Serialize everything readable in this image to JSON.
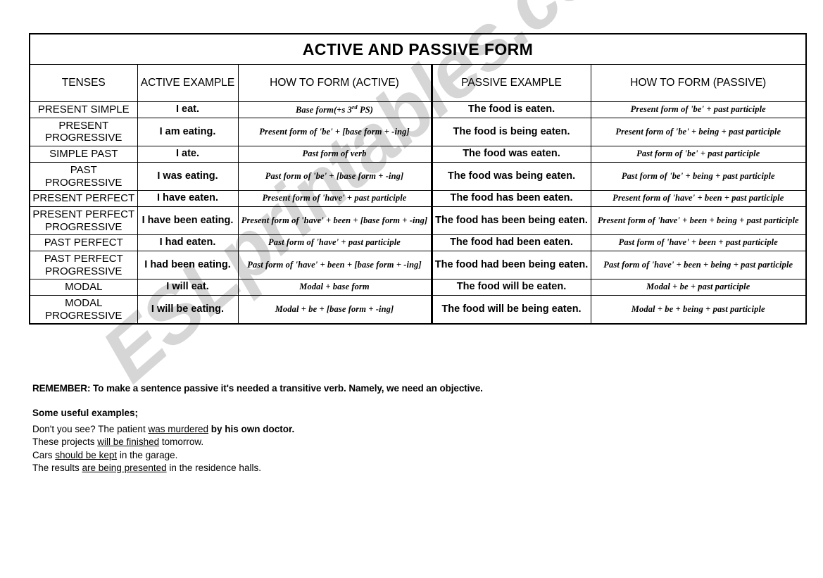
{
  "document": {
    "title": "ACTIVE AND PASSIVE FORM",
    "watermark": "ESLprintables.com"
  },
  "table": {
    "headers": {
      "tenses": "TENSES",
      "active_example": "ACTIVE EXAMPLE",
      "how_to_form_active": "HOW TO FORM (ACTIVE)",
      "passive_example": "PASSIVE EXAMPLE",
      "how_to_form_passive": "HOW TO FORM (PASSIVE)"
    },
    "rows": [
      {
        "tense": "PRESENT SIMPLE",
        "active_example": "I eat.",
        "active_form_pre": "Base form(+s 3",
        "active_form_sup": "rd",
        "active_form_post": " PS)",
        "passive_example": "The food is eaten.",
        "passive_form": "Present form of 'be' + past participle"
      },
      {
        "tense": "PRESENT PROGRESSIVE",
        "active_example": "I am eating.",
        "active_form": "Present form of 'be' + [base form + -ing]",
        "passive_example": "The food is being eaten.",
        "passive_form": "Present form of 'be' + being + past participle"
      },
      {
        "tense": "SIMPLE PAST",
        "active_example": "I ate.",
        "active_form": "Past form of verb",
        "passive_example": "The food was eaten.",
        "passive_form": "Past form of 'be' + past participle"
      },
      {
        "tense": "PAST PROGRESSIVE",
        "active_example": "I was eating.",
        "active_form": "Past form of 'be' + [base form + -ing]",
        "passive_example": "The food was being eaten.",
        "passive_form": "Past form of 'be' + being + past participle"
      },
      {
        "tense": "PRESENT PERFECT",
        "active_example": "I have eaten.",
        "active_form": "Present form of 'have' + past participle",
        "passive_example": "The food has been eaten.",
        "passive_form": "Present form of 'have' + been + past participle"
      },
      {
        "tense": "PRESENT PERFECT PROGRESSIVE",
        "active_example": "I have been eating.",
        "active_form": "Present form of 'have' + been + [base form + -ing]",
        "passive_example": "The food has been being eaten.",
        "passive_form": "Present form of 'have' + been + being + past participle"
      },
      {
        "tense": "PAST PERFECT",
        "active_example": "I had eaten.",
        "active_form": "Past form of 'have' + past participle",
        "passive_example": "The food had been eaten.",
        "passive_form": "Past form of 'have' + been + past participle"
      },
      {
        "tense": "PAST PERFECT PROGRESSIVE",
        "active_example": "I had been eating.",
        "active_form": "Past form of 'have' + been + [base form + -ing]",
        "passive_example": "The food had been being eaten.",
        "passive_form": "Past form of 'have' + been + being + past participle"
      },
      {
        "tense": "MODAL",
        "active_example": "I will eat.",
        "active_form": "Modal + base form",
        "passive_example": "The food will be eaten.",
        "passive_form": "Modal + be + past participle"
      },
      {
        "tense": "MODAL PROGRESSIVE",
        "active_example": "I will be eating.",
        "active_form": "Modal + be + [base form + -ing]",
        "passive_example": "The food will be being eaten.",
        "passive_form": "Modal + be + being + past participle"
      }
    ]
  },
  "notes": {
    "remember": "REMEMBER: To make a sentence passive it's needed a transitive verb. Namely, we need an objective.",
    "examples_title": "Some useful examples;",
    "examples": [
      {
        "before": "Don't you see? The patient ",
        "underlined": "was murdered",
        "after": " by his own doctor.",
        "after_bold": true
      },
      {
        "before": "These projects ",
        "underlined": "will be finished",
        "after": " tomorrow.",
        "after_bold": false
      },
      {
        "before": "Cars ",
        "underlined": "should be kept",
        "after": " in the garage.",
        "after_bold": false
      },
      {
        "before": "The results ",
        "underlined": "are being presented",
        "after": " in the residence halls.",
        "after_bold": false
      }
    ]
  }
}
